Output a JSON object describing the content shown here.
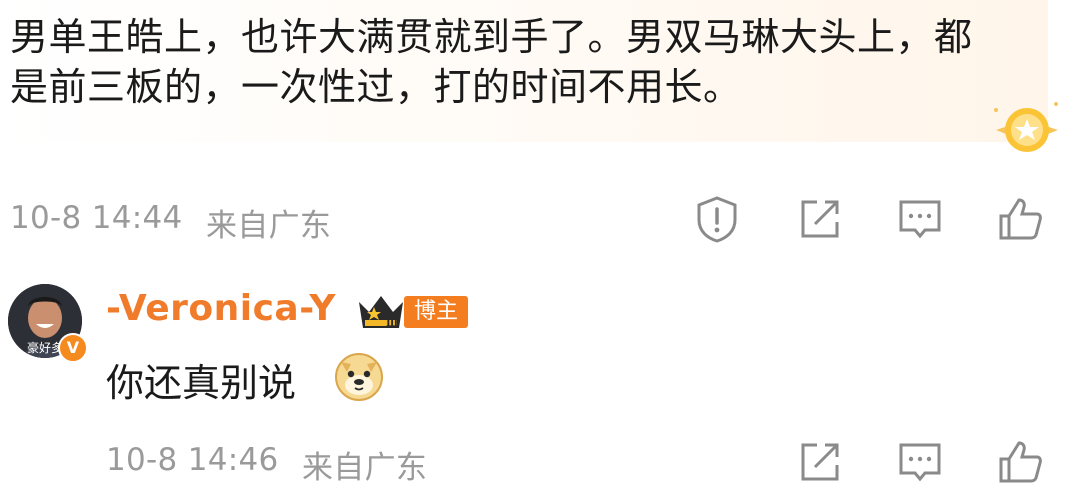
{
  "comment": {
    "text": "男单王皓上，也许大满贯就到手了。男双马琳大头上，都是前三板的，一次性过，打的时间不用长。",
    "timestamp": "10-8 14:44",
    "location": "来自广东",
    "actions": [
      "report-icon",
      "share-icon",
      "comment-icon",
      "like-icon"
    ]
  },
  "reply": {
    "username": "-Veronica-Y",
    "author_badge": "博主",
    "text": "你还真别说",
    "emoji": "doge-emoji",
    "timestamp": "10-8 14:46",
    "location": "来自广东",
    "actions": [
      "share-icon",
      "comment-icon",
      "like-icon"
    ],
    "avatar_tag": "豪好多"
  },
  "colors": {
    "username": "#f07c2b",
    "badge": "#f47d20",
    "meta_text": "#9a9a9a",
    "icon": "#8a8a8a"
  }
}
